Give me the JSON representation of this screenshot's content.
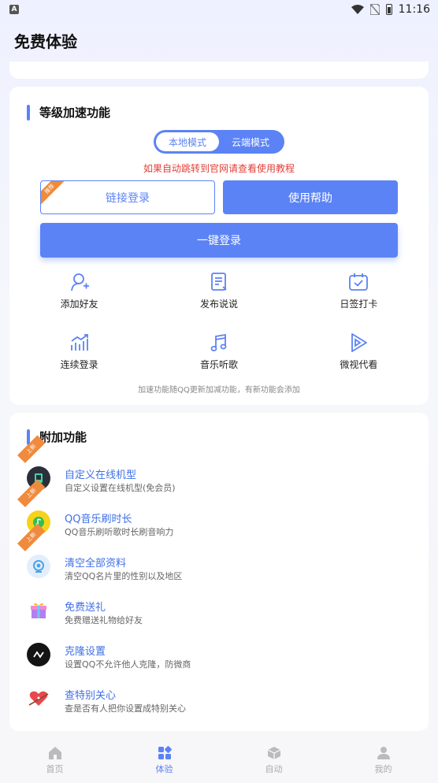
{
  "status_bar": {
    "badge": "A",
    "time": "11:16"
  },
  "header": {
    "title": "免费体验"
  },
  "speed_card": {
    "title": "等级加速功能",
    "modes": [
      "本地模式",
      "云端模式"
    ],
    "notice": "如果自动跳转到官网请查看使用教程",
    "link_login": "链接登录",
    "link_badge": "推荐",
    "help": "使用帮助",
    "one_click": "一键登录",
    "features": [
      {
        "label": "添加好友",
        "icon": "add-friend-icon"
      },
      {
        "label": "发布说说",
        "icon": "post-status-icon"
      },
      {
        "label": "日签打卡",
        "icon": "daily-checkin-icon"
      },
      {
        "label": "连续登录",
        "icon": "continuous-login-icon"
      },
      {
        "label": "音乐听歌",
        "icon": "music-icon"
      },
      {
        "label": "微视代看",
        "icon": "video-play-icon"
      }
    ],
    "footnote": "加速功能随QQ更新加减功能，有新功能会添加"
  },
  "extra_card": {
    "title": "附加功能",
    "items": [
      {
        "title": "自定义在线机型",
        "desc": "自定义设置在线机型(免会员)",
        "tag": "上新",
        "icon": "device-model-icon"
      },
      {
        "title": "QQ音乐刷时长",
        "desc": "QQ音乐刷听歌时长刷音响力",
        "tag": "上新",
        "icon": "qq-music-icon"
      },
      {
        "title": "清空全部资料",
        "desc": "清空QQ名片里的性别以及地区",
        "tag": "上新",
        "icon": "clear-profile-icon"
      },
      {
        "title": "免费送礼",
        "desc": "免费赠送礼物给好友",
        "icon": "gift-icon"
      },
      {
        "title": "克隆设置",
        "desc": "设置QQ不允许他人克隆，防微商",
        "icon": "clone-icon"
      },
      {
        "title": "查特别关心",
        "desc": "查是否有人把你设置成特别关心",
        "icon": "heart-icon"
      }
    ]
  },
  "bottom_nav": [
    {
      "label": "首页",
      "icon": "home-icon"
    },
    {
      "label": "体验",
      "icon": "experience-icon"
    },
    {
      "label": "自动",
      "icon": "auto-icon"
    },
    {
      "label": "我的",
      "icon": "profile-icon"
    }
  ],
  "colors": {
    "accent": "#5b83f5",
    "warning": "#e0403a",
    "tag": "#f08a3c"
  }
}
